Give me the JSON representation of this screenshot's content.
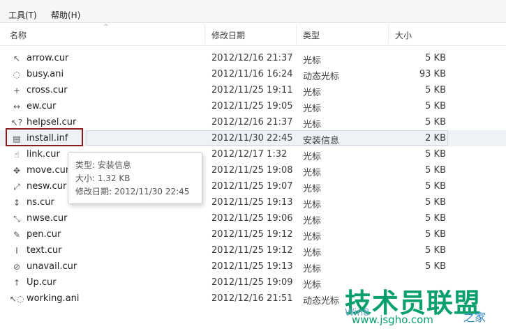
{
  "menu": {
    "tools": "工具(T)",
    "help": "帮助(H)"
  },
  "columns": {
    "name": "名称",
    "date": "修改日期",
    "type": "类型",
    "size": "大小"
  },
  "files": [
    {
      "name": "arrow.cur",
      "date": "2012/12/16 21:37",
      "type": "光标",
      "size": "5 KB",
      "icon": "arrow-cursor-icon"
    },
    {
      "name": "busy.ani",
      "date": "2012/11/16 16:24",
      "type": "动态光标",
      "size": "93 KB",
      "icon": "busy-cursor-icon"
    },
    {
      "name": "cross.cur",
      "date": "2012/11/25 19:11",
      "type": "光标",
      "size": "5 KB",
      "icon": "cross-cursor-icon"
    },
    {
      "name": "ew.cur",
      "date": "2012/11/25 19:05",
      "type": "光标",
      "size": "5 KB",
      "icon": "ew-resize-cursor-icon"
    },
    {
      "name": "helpsel.cur",
      "date": "2012/12/16 21:37",
      "type": "光标",
      "size": "5 KB",
      "icon": "help-cursor-icon"
    },
    {
      "name": "install.inf",
      "date": "2012/11/30 22:45",
      "type": "安装信息",
      "size": "2 KB",
      "icon": "setup-info-file-icon"
    },
    {
      "name": "link.cur",
      "date": "2012/12/17 1:32",
      "type": "光标",
      "size": "5 KB",
      "icon": "link-cursor-icon"
    },
    {
      "name": "move.cur",
      "date": "2012/11/25 19:08",
      "type": "光标",
      "size": "5 KB",
      "icon": "move-cursor-icon"
    },
    {
      "name": "nesw.cur",
      "date": "2012/11/25 19:07",
      "type": "光标",
      "size": "5 KB",
      "icon": "nesw-resize-cursor-icon"
    },
    {
      "name": "ns.cur",
      "date": "2012/11/25 19:13",
      "type": "光标",
      "size": "5 KB",
      "icon": "ns-resize-cursor-icon"
    },
    {
      "name": "nwse.cur",
      "date": "2012/11/25 19:06",
      "type": "光标",
      "size": "5 KB",
      "icon": "nwse-resize-cursor-icon"
    },
    {
      "name": "pen.cur",
      "date": "2012/11/25 19:12",
      "type": "光标",
      "size": "5 KB",
      "icon": "pen-cursor-icon"
    },
    {
      "name": "text.cur",
      "date": "2012/11/25 19:12",
      "type": "光标",
      "size": "5 KB",
      "icon": "text-cursor-icon"
    },
    {
      "name": "unavail.cur",
      "date": "2012/11/25 19:13",
      "type": "光标",
      "size": "5 KB",
      "icon": "unavailable-cursor-icon"
    },
    {
      "name": "Up.cur",
      "date": "2012/11/25 19:09",
      "type": "光标",
      "size": "",
      "icon": "up-arrow-cursor-icon"
    },
    {
      "name": "working.ani",
      "date": "2012/12/16 21:51",
      "type": "动态光标",
      "size": "",
      "icon": "working-cursor-icon"
    }
  ],
  "highlighted_index": 5,
  "tooltip": {
    "type_line": "类型: 安装信息",
    "size_line": "大小: 1.32 KB",
    "date_line": "修改日期: 2012/11/30 22:45"
  },
  "watermark": {
    "brand": "技术员联盟",
    "url": "www.jsgho.com",
    "win_text": "Win8",
    "suffix": "之家"
  },
  "colors": {
    "watermark": "#0aa06e",
    "highlight_box": "#8b1d1d",
    "selection_bg": "#eef1f5"
  }
}
